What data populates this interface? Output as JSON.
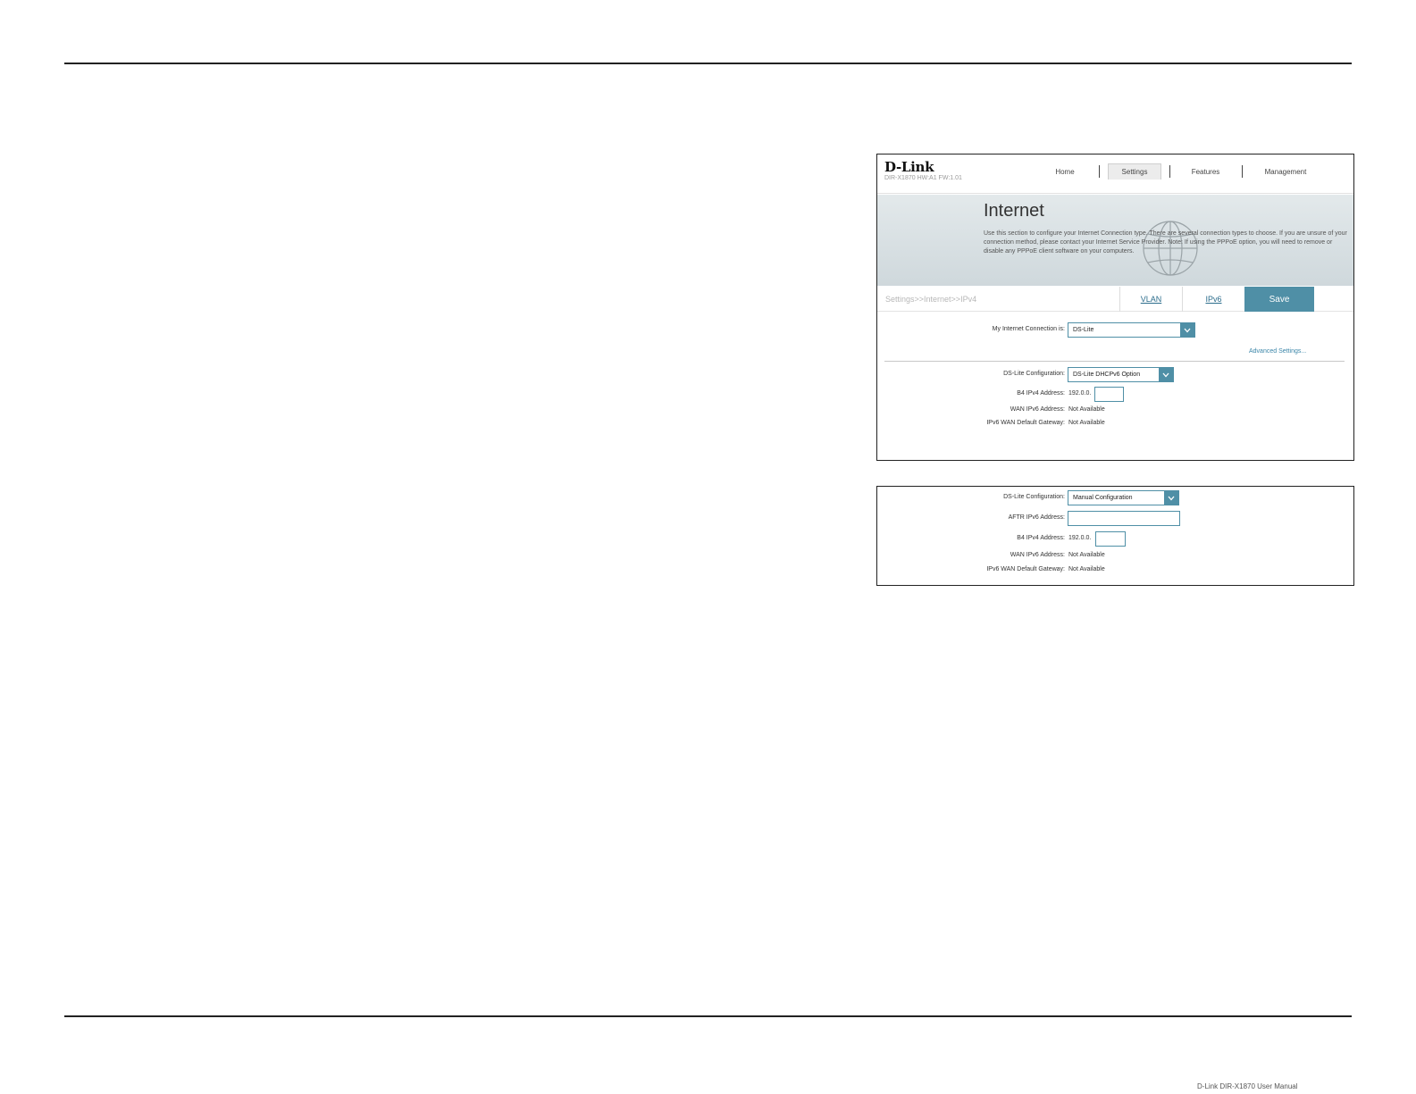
{
  "router": {
    "brand": "D-Link",
    "model_info": "DIR-X1870 HW:A1 FW:1.01",
    "nav": {
      "home": "Home",
      "settings": "Settings",
      "features": "Features",
      "management": "Management"
    }
  },
  "hero": {
    "title": "Internet",
    "description": "Use this section to configure your Internet Connection type. There are several connection types to choose. If you are unsure of your connection method, please contact your Internet Service Provider. Note: If using the PPPoE option, you will need to remove or disable any PPPoE client software on your computers."
  },
  "tabs": {
    "breadcrumb": "Settings>>Internet>>IPv4",
    "vlan": "VLAN",
    "ipv6": "IPv6",
    "save": "Save"
  },
  "form1": {
    "connection_label": "My Internet Connection is:",
    "connection_value": "DS-Lite",
    "advanced_link": "Advanced Settings...",
    "dslite_label": "DS-Lite Configuration:",
    "dslite_value": "DS-Lite DHCPv6 Option",
    "b4_label": "B4 IPv4 Address:",
    "b4_prefix": "192.0.0.",
    "wan_label": "WAN IPv6 Address:",
    "wan_value": "Not Available",
    "gateway_label": "IPv6 WAN Default Gateway:",
    "gateway_value": "Not Available"
  },
  "form2": {
    "dslite_label": "DS-Lite Configuration:",
    "dslite_value": "Manual Configuration",
    "aftr_label": "AFTR IPv6 Address:",
    "b4_label": "B4 IPv4 Address:",
    "b4_prefix": "192.0.0.",
    "wan_label": "WAN IPv6 Address:",
    "wan_value": "Not Available",
    "gateway_label": "IPv6 WAN Default Gateway:",
    "gateway_value": "Not Available"
  },
  "footer": {
    "text": "D-Link DIR-X1870 User Manual"
  },
  "colors": {
    "accent": "#4f8fa6",
    "link": "#2c6d8c"
  }
}
